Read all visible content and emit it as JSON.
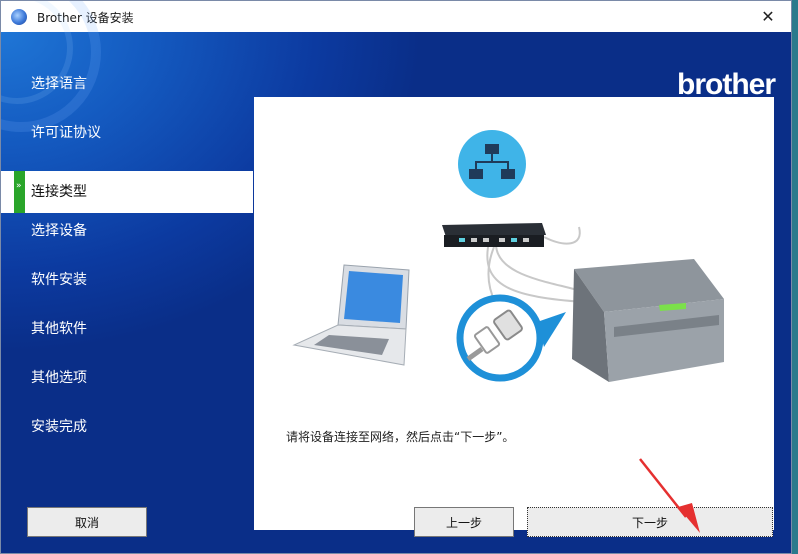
{
  "window": {
    "title": "Brother 设备安装",
    "close_glyph": "✕"
  },
  "brand": {
    "logo_text": "brother"
  },
  "sidebar": {
    "items": [
      {
        "label": "选择语言",
        "active": false
      },
      {
        "label": "许可证协议",
        "active": false
      },
      {
        "label": "连接类型",
        "active": true
      },
      {
        "label": "选择设备",
        "active": false
      },
      {
        "label": "软件安装",
        "active": false
      },
      {
        "label": "其他软件",
        "active": false
      },
      {
        "label": "其他选项",
        "active": false
      },
      {
        "label": "安装完成",
        "active": false
      }
    ]
  },
  "main": {
    "instruction": "请将设备连接至网络，然后点击“下一步”。",
    "illustration_icons": [
      "network-icon",
      "router",
      "laptop",
      "ethernet-cable",
      "printer"
    ]
  },
  "buttons": {
    "cancel": "取消",
    "back": "上一步",
    "next": "下一步"
  },
  "colors": {
    "accent_blue": "#0c3aa0",
    "active_marker": "#2aa52a",
    "network_icon_bg": "#3fb4e8",
    "annotation_arrow": "#e53030"
  }
}
